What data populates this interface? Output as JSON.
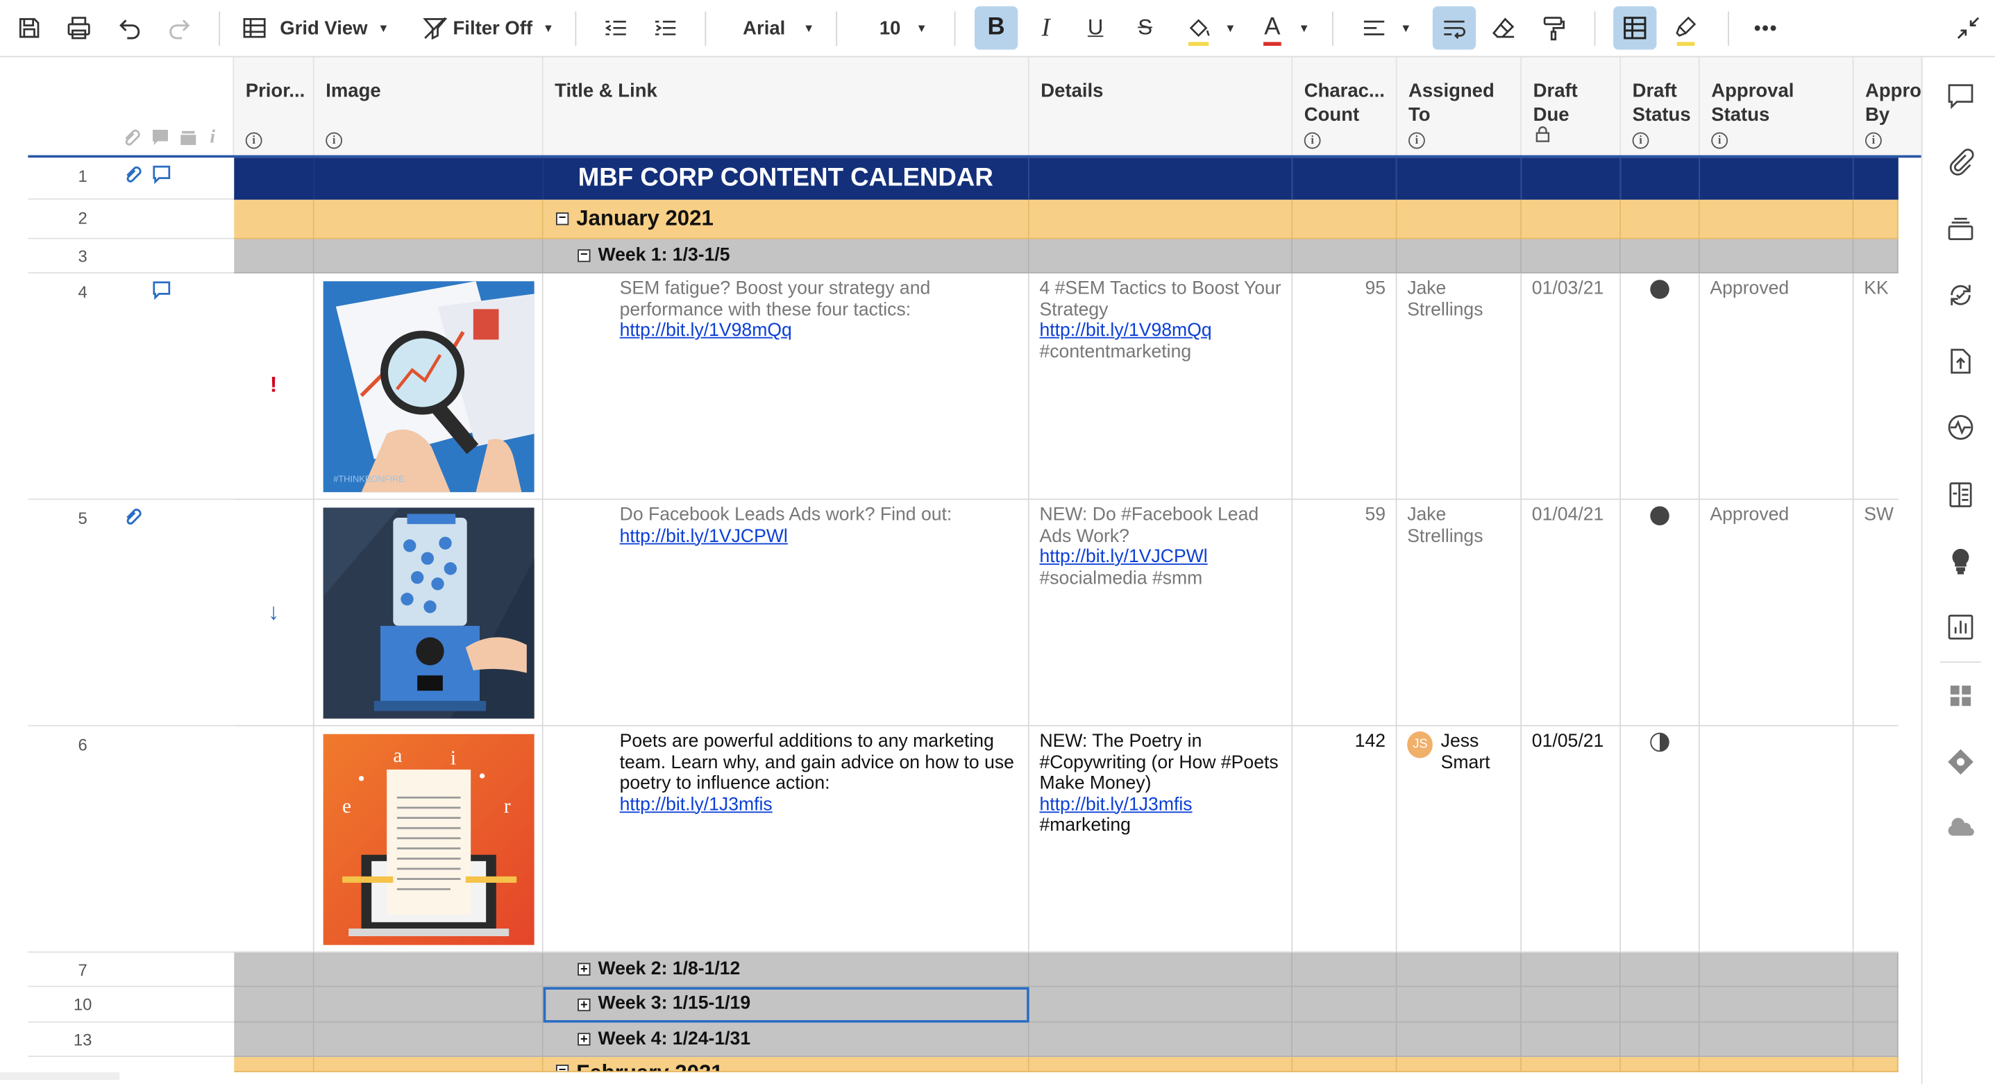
{
  "toolbar": {
    "view_label": "Grid View",
    "filter_label": "Filter Off",
    "font_name": "Arial",
    "font_size": "10",
    "more_label": "•••",
    "fill_swatch": "#f5d84b",
    "text_swatch": "#d9302b",
    "highlight_swatch": "#f5d84b"
  },
  "columns": {
    "priority": "Prior...",
    "image": "Image",
    "title_link": "Title & Link",
    "details": "Details",
    "char_count_1": "Charac...",
    "char_count_2": "Count",
    "assigned_1": "Assigned",
    "assigned_2": "To",
    "draft_due_1": "Draft",
    "draft_due_2": "Due",
    "draft_status_1": "Draft",
    "draft_status_2": "Status",
    "approval_status_1": "Approval",
    "approval_status_2": "Status",
    "approved_by_1": "Appro",
    "approved_by_2": "By",
    "info_glyph": "i"
  },
  "bands": {
    "title": "MBF CORP CONTENT CALENDAR",
    "january": "January 2021",
    "week1": "Week 1: 1/3-1/5",
    "week2": "Week 2: 1/8-1/12",
    "week3": "Week 3: 1/15-1/19",
    "week4": "Week 4: 1/24-1/31",
    "february": "February 2021",
    "collapse_glyph": "−",
    "expand_glyph": "+"
  },
  "row_numbers": {
    "r1": "1",
    "r2": "2",
    "r3": "3",
    "r4": "4",
    "r5": "5",
    "r6": "6",
    "r7": "7",
    "r10": "10",
    "r13": "13"
  },
  "rows": [
    {
      "priority_glyph": "!",
      "title_text": "SEM fatigue? Boost your strategy and performance with these four tactics:",
      "title_link": "http://bit.ly/1V98mQq",
      "details_text": "4 #SEM Tactics to Boost Your Strategy",
      "details_link": "http://bit.ly/1V98mQq",
      "details_tags": "#contentmarketing",
      "char_count": "95",
      "assigned": "Jake Strellings",
      "draft_due": "01/03/21",
      "draft_status": "complete",
      "approval_status": "Approved",
      "approved_by": "KK"
    },
    {
      "priority_glyph": "↓",
      "title_text": "Do Facebook Leads Ads work? Find out:",
      "title_link": "http://bit.ly/1VJCPWl",
      "details_text": "NEW: Do #Facebook Lead Ads Work?",
      "details_link": "http://bit.ly/1VJCPWl",
      "details_tags": "#socialmedia #smm",
      "char_count": "59",
      "assigned": "Jake Strellings",
      "draft_due": "01/04/21",
      "draft_status": "complete",
      "approval_status": "Approved",
      "approved_by": "SW"
    },
    {
      "priority_glyph": "",
      "title_text": "Poets are powerful additions to any marketing team. Learn why, and gain advice on how to use poetry to influence action:",
      "title_link": "http://bit.ly/1J3mfis",
      "details_text": "NEW: The Poetry in #Copywriting (or How #Poets Make Money)",
      "details_link": "http://bit.ly/1J3mfis",
      "details_tags": "#marketing",
      "char_count": "142",
      "assigned_initials": "JS",
      "assigned": "Jess Smart",
      "draft_due": "01/05/21",
      "draft_status": "half",
      "approval_status": "",
      "approved_by": ""
    }
  ],
  "colors": {
    "title_band": "#14307a",
    "month_band": "#f7cf86",
    "week_band": "#c4c4c4",
    "link": "#0b3fd6",
    "priority_high": "#d0021b",
    "priority_low": "#2a6dc4",
    "selection": "#2a6dc4"
  }
}
